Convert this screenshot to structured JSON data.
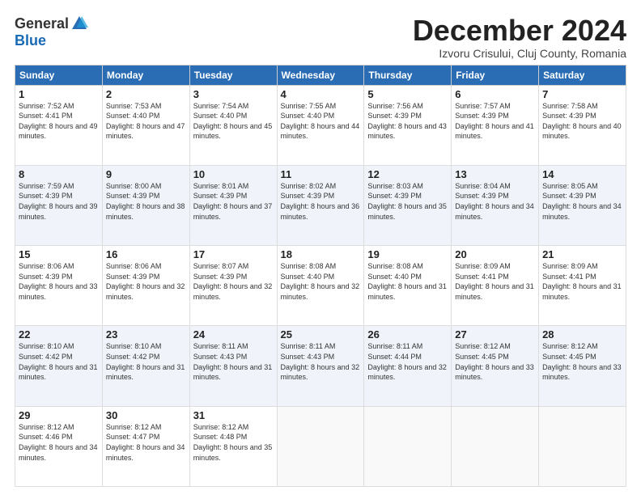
{
  "logo": {
    "general": "General",
    "blue": "Blue"
  },
  "title": "December 2024",
  "location": "Izvoru Crisului, Cluj County, Romania",
  "days_of_week": [
    "Sunday",
    "Monday",
    "Tuesday",
    "Wednesday",
    "Thursday",
    "Friday",
    "Saturday"
  ],
  "weeks": [
    [
      {
        "day": "1",
        "sunrise": "7:52 AM",
        "sunset": "4:41 PM",
        "daylight": "8 hours and 49 minutes."
      },
      {
        "day": "2",
        "sunrise": "7:53 AM",
        "sunset": "4:40 PM",
        "daylight": "8 hours and 47 minutes."
      },
      {
        "day": "3",
        "sunrise": "7:54 AM",
        "sunset": "4:40 PM",
        "daylight": "8 hours and 45 minutes."
      },
      {
        "day": "4",
        "sunrise": "7:55 AM",
        "sunset": "4:40 PM",
        "daylight": "8 hours and 44 minutes."
      },
      {
        "day": "5",
        "sunrise": "7:56 AM",
        "sunset": "4:39 PM",
        "daylight": "8 hours and 43 minutes."
      },
      {
        "day": "6",
        "sunrise": "7:57 AM",
        "sunset": "4:39 PM",
        "daylight": "8 hours and 41 minutes."
      },
      {
        "day": "7",
        "sunrise": "7:58 AM",
        "sunset": "4:39 PM",
        "daylight": "8 hours and 40 minutes."
      }
    ],
    [
      {
        "day": "8",
        "sunrise": "7:59 AM",
        "sunset": "4:39 PM",
        "daylight": "8 hours and 39 minutes."
      },
      {
        "day": "9",
        "sunrise": "8:00 AM",
        "sunset": "4:39 PM",
        "daylight": "8 hours and 38 minutes."
      },
      {
        "day": "10",
        "sunrise": "8:01 AM",
        "sunset": "4:39 PM",
        "daylight": "8 hours and 37 minutes."
      },
      {
        "day": "11",
        "sunrise": "8:02 AM",
        "sunset": "4:39 PM",
        "daylight": "8 hours and 36 minutes."
      },
      {
        "day": "12",
        "sunrise": "8:03 AM",
        "sunset": "4:39 PM",
        "daylight": "8 hours and 35 minutes."
      },
      {
        "day": "13",
        "sunrise": "8:04 AM",
        "sunset": "4:39 PM",
        "daylight": "8 hours and 34 minutes."
      },
      {
        "day": "14",
        "sunrise": "8:05 AM",
        "sunset": "4:39 PM",
        "daylight": "8 hours and 34 minutes."
      }
    ],
    [
      {
        "day": "15",
        "sunrise": "8:06 AM",
        "sunset": "4:39 PM",
        "daylight": "8 hours and 33 minutes."
      },
      {
        "day": "16",
        "sunrise": "8:06 AM",
        "sunset": "4:39 PM",
        "daylight": "8 hours and 32 minutes."
      },
      {
        "day": "17",
        "sunrise": "8:07 AM",
        "sunset": "4:39 PM",
        "daylight": "8 hours and 32 minutes."
      },
      {
        "day": "18",
        "sunrise": "8:08 AM",
        "sunset": "4:40 PM",
        "daylight": "8 hours and 32 minutes."
      },
      {
        "day": "19",
        "sunrise": "8:08 AM",
        "sunset": "4:40 PM",
        "daylight": "8 hours and 31 minutes."
      },
      {
        "day": "20",
        "sunrise": "8:09 AM",
        "sunset": "4:41 PM",
        "daylight": "8 hours and 31 minutes."
      },
      {
        "day": "21",
        "sunrise": "8:09 AM",
        "sunset": "4:41 PM",
        "daylight": "8 hours and 31 minutes."
      }
    ],
    [
      {
        "day": "22",
        "sunrise": "8:10 AM",
        "sunset": "4:42 PM",
        "daylight": "8 hours and 31 minutes."
      },
      {
        "day": "23",
        "sunrise": "8:10 AM",
        "sunset": "4:42 PM",
        "daylight": "8 hours and 31 minutes."
      },
      {
        "day": "24",
        "sunrise": "8:11 AM",
        "sunset": "4:43 PM",
        "daylight": "8 hours and 31 minutes."
      },
      {
        "day": "25",
        "sunrise": "8:11 AM",
        "sunset": "4:43 PM",
        "daylight": "8 hours and 32 minutes."
      },
      {
        "day": "26",
        "sunrise": "8:11 AM",
        "sunset": "4:44 PM",
        "daylight": "8 hours and 32 minutes."
      },
      {
        "day": "27",
        "sunrise": "8:12 AM",
        "sunset": "4:45 PM",
        "daylight": "8 hours and 33 minutes."
      },
      {
        "day": "28",
        "sunrise": "8:12 AM",
        "sunset": "4:45 PM",
        "daylight": "8 hours and 33 minutes."
      }
    ],
    [
      {
        "day": "29",
        "sunrise": "8:12 AM",
        "sunset": "4:46 PM",
        "daylight": "8 hours and 34 minutes."
      },
      {
        "day": "30",
        "sunrise": "8:12 AM",
        "sunset": "4:47 PM",
        "daylight": "8 hours and 34 minutes."
      },
      {
        "day": "31",
        "sunrise": "8:12 AM",
        "sunset": "4:48 PM",
        "daylight": "8 hours and 35 minutes."
      },
      null,
      null,
      null,
      null
    ]
  ]
}
